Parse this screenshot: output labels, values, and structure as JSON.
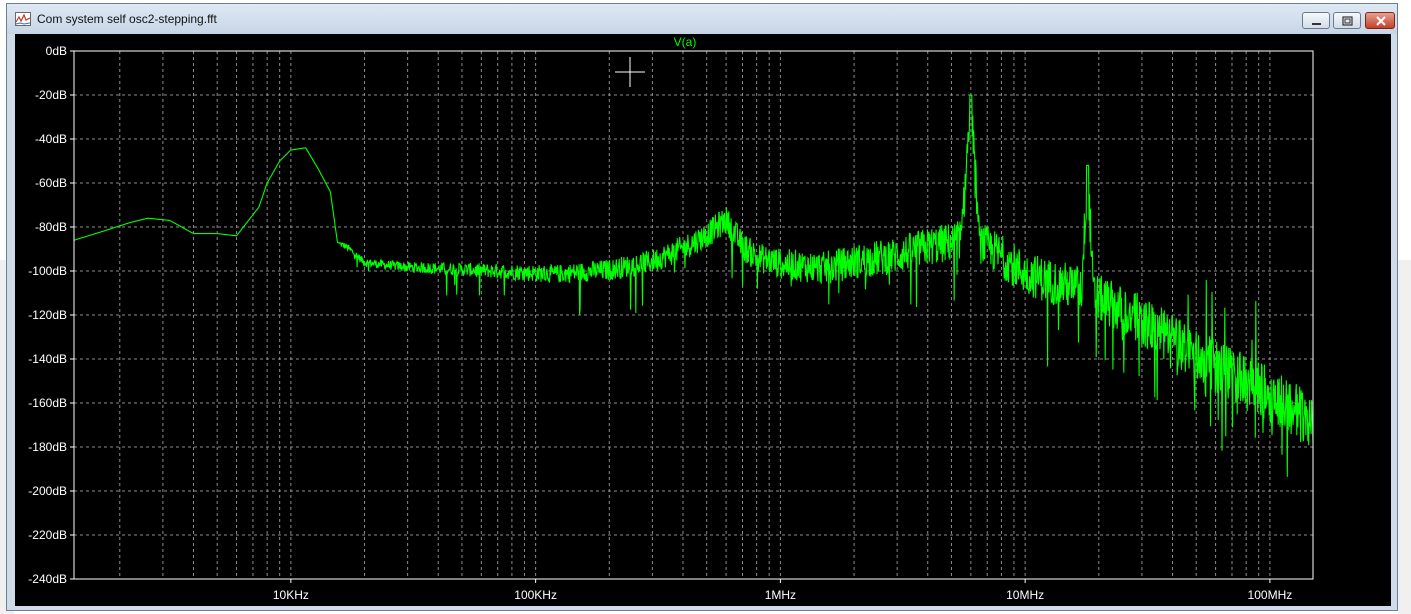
{
  "window": {
    "title": "Com system self osc2-stepping.fft",
    "icon": "waveform-app-icon"
  },
  "colors": {
    "background": "#000000",
    "trace": "#00ff00",
    "grid": "#8c8c8c",
    "axis_text": "#ffffff"
  },
  "chart_data": {
    "type": "line",
    "title": "V(a)",
    "xlabel": "",
    "ylabel": "",
    "xscale": "log",
    "xlim": [
      1300,
      150000000
    ],
    "ylim": [
      -240,
      0
    ],
    "yticks": [
      0,
      -20,
      -40,
      -60,
      -80,
      -100,
      -120,
      -140,
      -160,
      -180,
      -200,
      -220,
      -240
    ],
    "ytick_labels": [
      "0dB",
      "-20dB",
      "-40dB",
      "-60dB",
      "-80dB",
      "-100dB",
      "-120dB",
      "-140dB",
      "-160dB",
      "-180dB",
      "-200dB",
      "-220dB",
      "-240dB"
    ],
    "xticks": [
      10000,
      100000,
      1000000,
      10000000,
      100000000
    ],
    "xtick_labels": [
      "10KHz",
      "100KHz",
      "1MHz",
      "10MHz",
      "100MHz"
    ],
    "grid": true,
    "series": [
      {
        "name": "V(a)",
        "color": "#00ff00",
        "points": [
          [
            1300,
            -86
          ],
          [
            1700,
            -82
          ],
          [
            2200,
            -78
          ],
          [
            2600,
            -76
          ],
          [
            3200,
            -77
          ],
          [
            4000,
            -83
          ],
          [
            5000,
            -83
          ],
          [
            6000,
            -84
          ],
          [
            6500,
            -79
          ],
          [
            7400,
            -71
          ],
          [
            8000,
            -60
          ],
          [
            9000,
            -50
          ],
          [
            10000,
            -45
          ],
          [
            11500,
            -44
          ],
          [
            13000,
            -54
          ],
          [
            14500,
            -64
          ],
          [
            15500,
            -87
          ],
          [
            17000,
            -89
          ],
          [
            20000,
            -96
          ],
          [
            30000,
            -98
          ],
          [
            50000,
            -99
          ],
          [
            80000,
            -100
          ],
          [
            120000,
            -101
          ],
          [
            200000,
            -99
          ],
          [
            300000,
            -95
          ],
          [
            400000,
            -89
          ],
          [
            500000,
            -83
          ],
          [
            600000,
            -76
          ],
          [
            700000,
            -88
          ],
          [
            800000,
            -93
          ],
          [
            1000000,
            -96
          ],
          [
            1500000,
            -98
          ],
          [
            2000000,
            -95
          ],
          [
            3000000,
            -92
          ],
          [
            4000000,
            -88
          ],
          [
            5000000,
            -86
          ],
          [
            5500000,
            -84
          ],
          [
            6000000,
            -20
          ],
          [
            6500000,
            -86
          ],
          [
            8000000,
            -92
          ],
          [
            10000000,
            -100
          ],
          [
            13000000,
            -104
          ],
          [
            17000000,
            -107
          ],
          [
            18000000,
            -52
          ],
          [
            19000000,
            -110
          ],
          [
            25000000,
            -117
          ],
          [
            30000000,
            -122
          ],
          [
            40000000,
            -130
          ],
          [
            50000000,
            -137
          ],
          [
            70000000,
            -146
          ],
          [
            100000000,
            -155
          ],
          [
            130000000,
            -162
          ],
          [
            150000000,
            -167
          ]
        ]
      }
    ]
  }
}
